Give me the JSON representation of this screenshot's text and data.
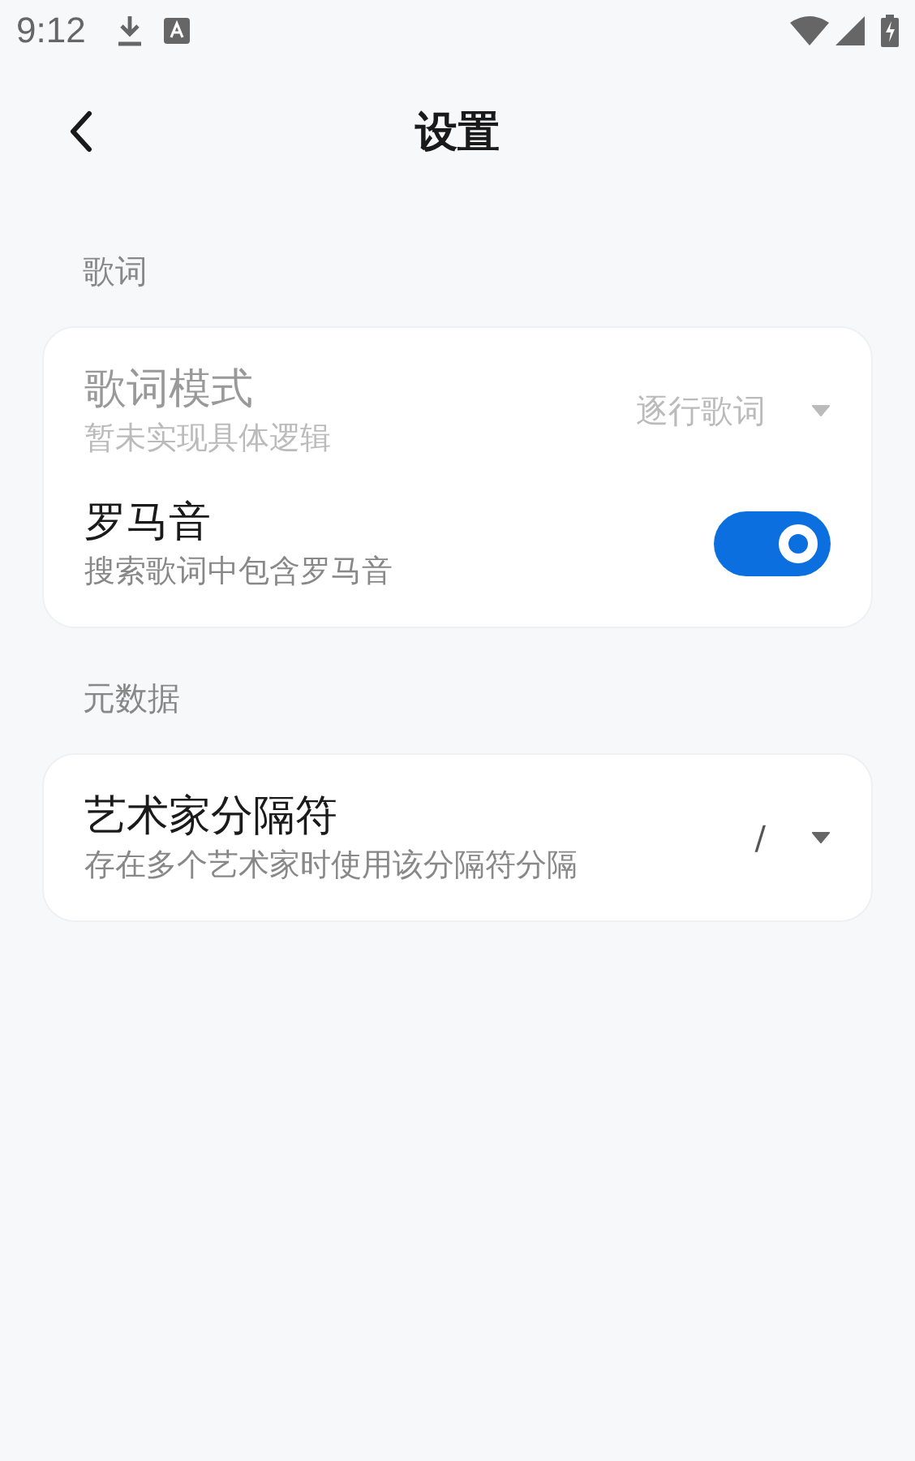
{
  "status_bar": {
    "time": "9:12"
  },
  "header": {
    "title": "设置"
  },
  "sections": [
    {
      "label": "歌词",
      "items": [
        {
          "kind": "dropdown",
          "title": "歌词模式",
          "subtitle": "暂未实现具体逻辑",
          "value": "逐行歌词",
          "disabled": true
        },
        {
          "kind": "switch",
          "title": "罗马音",
          "subtitle": "搜索歌词中包含罗马音",
          "on": true,
          "disabled": false
        }
      ]
    },
    {
      "label": "元数据",
      "items": [
        {
          "kind": "dropdown",
          "title": "艺术家分隔符",
          "subtitle": "存在多个艺术家时使用该分隔符分隔",
          "value": "/",
          "disabled": false
        }
      ]
    }
  ]
}
